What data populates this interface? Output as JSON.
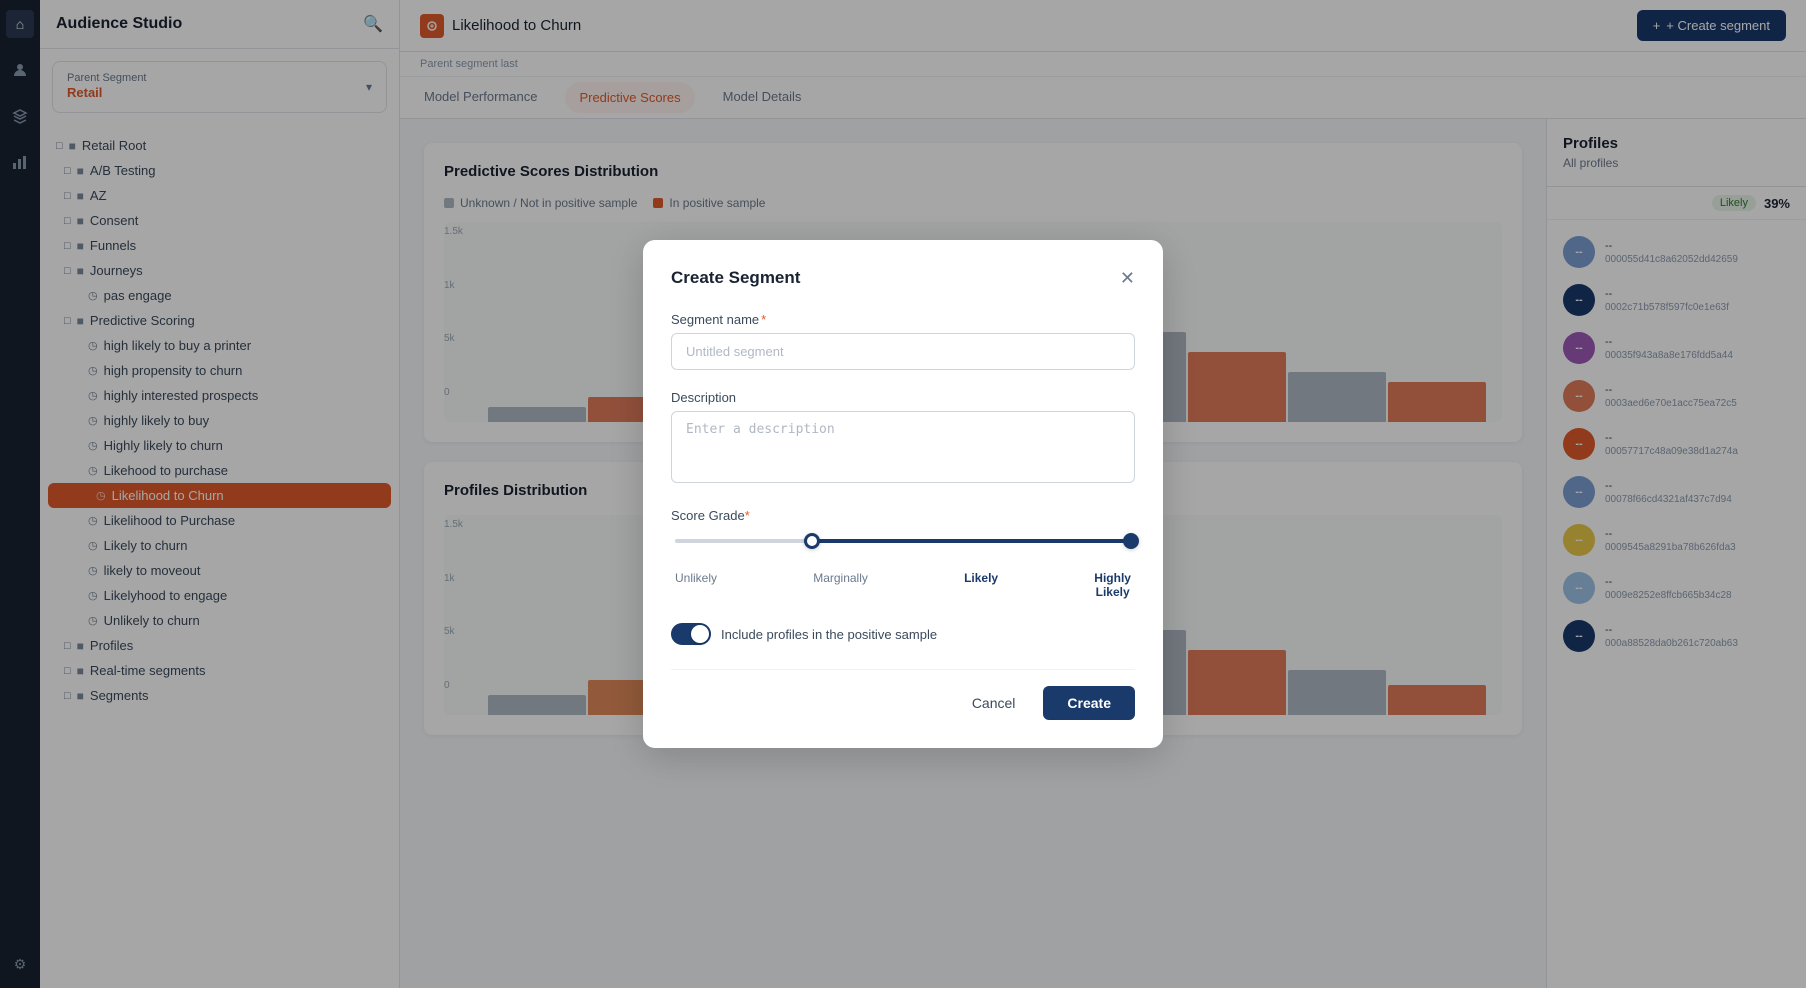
{
  "app": {
    "title": "Audience Studio"
  },
  "sidebar": {
    "search_icon": "🔍",
    "parent_segment": {
      "label": "Parent Segment",
      "value": "Retail"
    },
    "tree": [
      {
        "label": "Retail Root",
        "level": 0,
        "type": "folder",
        "icon": "■"
      },
      {
        "label": "A/B Testing",
        "level": 1,
        "type": "folder",
        "icon": "■"
      },
      {
        "label": "AZ",
        "level": 1,
        "type": "folder",
        "icon": "■"
      },
      {
        "label": "Consent",
        "level": 1,
        "type": "folder",
        "icon": "■"
      },
      {
        "label": "Funnels",
        "level": 1,
        "type": "folder",
        "icon": "■"
      },
      {
        "label": "Journeys",
        "level": 1,
        "type": "folder",
        "icon": "■"
      },
      {
        "label": "pas engage",
        "level": 2,
        "type": "item",
        "icon": "◷"
      },
      {
        "label": "Predictive Scoring",
        "level": 1,
        "type": "folder",
        "icon": "■"
      },
      {
        "label": "high likely to buy a printer",
        "level": 2,
        "type": "item",
        "icon": "◷"
      },
      {
        "label": "high propensity to churn",
        "level": 2,
        "type": "item",
        "icon": "◷"
      },
      {
        "label": "highly interested prospects",
        "level": 2,
        "type": "item",
        "icon": "◷"
      },
      {
        "label": "highly likely to buy",
        "level": 2,
        "type": "item",
        "icon": "◷"
      },
      {
        "label": "Highly likely to churn",
        "level": 2,
        "type": "item",
        "icon": "◷"
      },
      {
        "label": "Likehood to purchase",
        "level": 2,
        "type": "item",
        "icon": "◷"
      },
      {
        "label": "Likelihood to Churn",
        "level": 2,
        "type": "item",
        "icon": "◷",
        "active": true
      },
      {
        "label": "Likelihood to Purchase",
        "level": 2,
        "type": "item",
        "icon": "◷"
      },
      {
        "label": "Likely to churn",
        "level": 2,
        "type": "item",
        "icon": "◷"
      },
      {
        "label": "likely to moveout",
        "level": 2,
        "type": "item",
        "icon": "◷"
      },
      {
        "label": "Likelyhood to engage",
        "level": 2,
        "type": "item",
        "icon": "◷"
      },
      {
        "label": "Unlikely to churn",
        "level": 2,
        "type": "item",
        "icon": "◷"
      },
      {
        "label": "Profiles",
        "level": 1,
        "type": "folder",
        "icon": "■"
      },
      {
        "label": "Real-time segments",
        "level": 1,
        "type": "folder",
        "icon": "■"
      },
      {
        "label": "Segments",
        "level": 1,
        "type": "folder",
        "icon": "■"
      }
    ]
  },
  "topbar": {
    "churn_icon": "⊕",
    "title": "Likelihood to Churn",
    "create_segment_label": "+ Create segment",
    "info_text": "Parent segment last"
  },
  "tabs": [
    {
      "label": "Model Performance",
      "active": false
    },
    {
      "label": "Predictive Scores",
      "active": true
    },
    {
      "label": "Model Details",
      "active": false
    }
  ],
  "content": {
    "distribution_title": "Predictive Scores Distribution",
    "sample_labels": {
      "unknown": "Unknown / Not in positive sample",
      "in_positive": "In positive sample"
    },
    "profiles_distribution_title": "Profiles Distribution"
  },
  "profiles_panel": {
    "title": "Profiles",
    "subtitle": "All profiles",
    "score_labels": {
      "likely": "Likely",
      "pct": "39%"
    },
    "items": [
      {
        "id": "000055d41c8a62052dd42659",
        "short": "--",
        "color": "#7b9fd4"
      },
      {
        "id": "0002c71b578f597fc0e1e63f",
        "short": "--",
        "color": "#1a3a6b"
      },
      {
        "id": "00035f943a8a8e176fdd5a44",
        "short": "--",
        "color": "#9b59b6"
      },
      {
        "id": "0003aed6e70e1acc75ea72c5",
        "short": "--",
        "color": "#e07b5a"
      },
      {
        "id": "00057717c48a09e38d1a274a",
        "short": "--",
        "color": "#e05a2b"
      },
      {
        "id": "00078f66cd4321af437c7d94",
        "short": "--",
        "color": "#7b9fd4"
      },
      {
        "id": "0009545a8291ba78b626fda3",
        "short": "--",
        "color": "#e8c84a"
      },
      {
        "id": "0009e8252e8ffcb665b34c28",
        "short": "--",
        "color": "#9dc4e8"
      },
      {
        "id": "000a88528da0b261c720ab63",
        "short": "--",
        "color": "#1a3a6b"
      }
    ]
  },
  "modal": {
    "title": "Create Segment",
    "segment_name_label": "Segment name",
    "segment_name_placeholder": "Untitled segment",
    "description_label": "Description",
    "description_placeholder": "Enter a description",
    "score_grade_label": "Score Grade",
    "slider": {
      "labels": [
        "Unlikely",
        "Marginally",
        "Likely",
        "Highly Likely"
      ],
      "positions": [
        0,
        33,
        66,
        100
      ],
      "left_pos_pct": 30,
      "right_pos_pct": 100,
      "active_label": "Highly Likely"
    },
    "toggle_label": "Include profiles in the positive sample",
    "toggle_on": true,
    "cancel_label": "Cancel",
    "create_label": "Create"
  },
  "icons": {
    "nav_home": "⌂",
    "nav_users": "👤",
    "nav_layers": "⧉",
    "nav_chart": "📊",
    "nav_settings": "⚙",
    "close": "✕",
    "chevron_down": "▾",
    "plus": "+"
  }
}
